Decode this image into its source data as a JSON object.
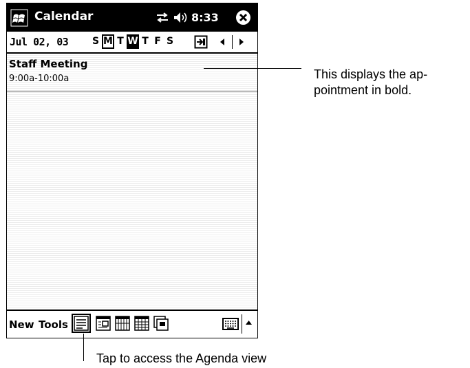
{
  "titlebar": {
    "app_title": "Calendar",
    "clock": "8:33",
    "icons": [
      "windows-start-icon",
      "sync-icon",
      "speaker-icon",
      "close-icon"
    ]
  },
  "daybar": {
    "date": "Jul 02, 03",
    "weekdays": [
      "S",
      "M",
      "T",
      "W",
      "T",
      "F",
      "S"
    ],
    "today_index": 1,
    "selected_index": 3
  },
  "agenda": {
    "appointments": [
      {
        "title": "Staff Meeting",
        "time": "9:00a-10:00a"
      }
    ]
  },
  "menubar": {
    "new_label": "New",
    "tools_label": "Tools",
    "views": [
      "agenda-view-icon",
      "day-view-icon",
      "week-view-icon",
      "month-view-icon",
      "year-view-icon"
    ],
    "active_view": "agenda"
  },
  "callouts": {
    "bold_note": "This displays the ap-\npointment in bold.",
    "agenda_note": "Tap to access the Agenda view"
  }
}
